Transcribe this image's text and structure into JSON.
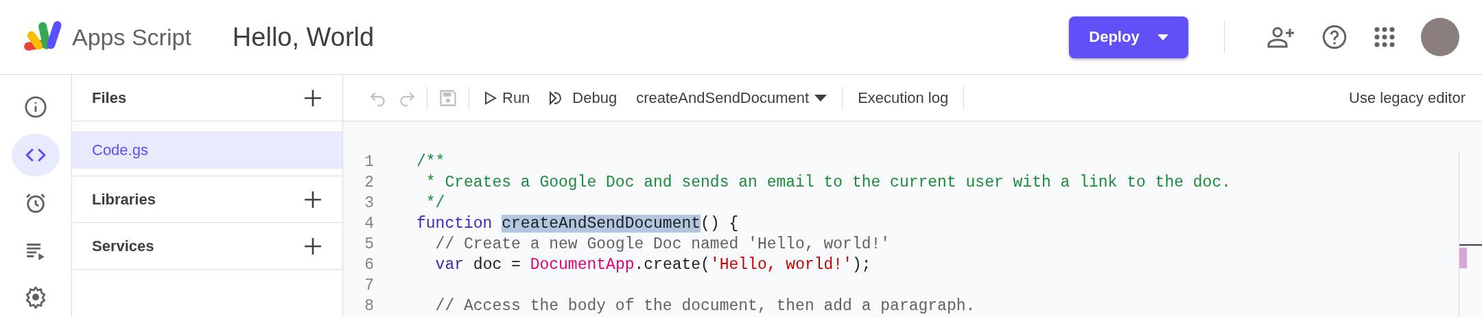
{
  "header": {
    "app_name": "Apps Script",
    "project_title": "Hello, World",
    "deploy_button": "Deploy"
  },
  "rail": [
    {
      "kind": "info",
      "selected": false
    },
    {
      "kind": "code",
      "selected": true
    },
    {
      "kind": "clock",
      "selected": false
    },
    {
      "kind": "executions",
      "selected": false
    },
    {
      "kind": "settings",
      "selected": false
    }
  ],
  "files_panel": {
    "sections": [
      {
        "kind": "header",
        "label": "Files"
      },
      {
        "kind": "file",
        "label": "Code.gs",
        "selected": true
      },
      {
        "kind": "header",
        "label": "Libraries"
      },
      {
        "kind": "header",
        "label": "Services"
      }
    ]
  },
  "toolbar": {
    "run": "Run",
    "debug": "Debug",
    "function_select": "createAndSendDocument",
    "execution_log": "Execution log",
    "legacy_link": "Use legacy editor"
  },
  "code_lines": [
    {
      "number": "1",
      "tokens": [
        {
          "kind": "comment",
          "text": "/**"
        }
      ]
    },
    {
      "number": "2",
      "tokens": [
        {
          "kind": "comment",
          "text": " * Creates a Google Doc and sends an email to the current user with a link to the doc."
        }
      ]
    },
    {
      "number": "3",
      "tokens": [
        {
          "kind": "comment",
          "text": " */"
        }
      ]
    },
    {
      "number": "4",
      "tokens": [
        {
          "kind": "keyword",
          "text": "function "
        },
        {
          "kind": "selected",
          "text": "createAndSendDocument"
        },
        {
          "kind": "plain",
          "text": "() {"
        }
      ]
    },
    {
      "number": "5",
      "tokens": [
        {
          "kind": "plain-comment",
          "text": "  // Create a new Google Doc named 'Hello, world!'"
        }
      ]
    },
    {
      "number": "6",
      "tokens": [
        {
          "kind": "keyword",
          "text": "  var "
        },
        {
          "kind": "plain",
          "text": "doc = "
        },
        {
          "kind": "class",
          "text": "DocumentApp"
        },
        {
          "kind": "plain",
          "text": ".create("
        },
        {
          "kind": "string",
          "text": "'Hello, world!'"
        },
        {
          "kind": "plain",
          "text": ");"
        }
      ]
    },
    {
      "number": "7"
    },
    {
      "number": "8",
      "tokens": [
        {
          "kind": "plain-comment",
          "text": "  // Access the body of the document, then add a paragraph."
        }
      ]
    }
  ]
}
